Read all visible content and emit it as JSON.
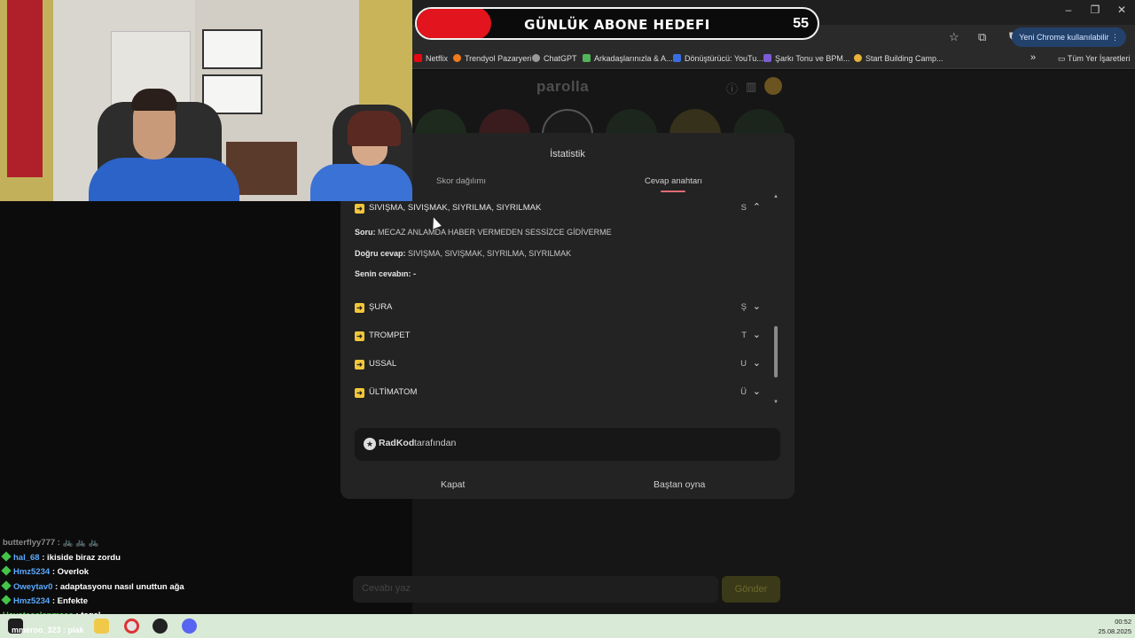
{
  "overlay": {
    "title": "GÜNLÜK ABONE HEDEFI",
    "count": "55"
  },
  "browser": {
    "window_controls": [
      "–",
      "❐",
      "✕"
    ],
    "chrome_pill": "Yeni Chrome kullanılabilir",
    "bookmarks": [
      "Netflix",
      "Trendyol Pazaryeri",
      "ChatGPT",
      "Arkadaşlarınızla & A...",
      "Dönüştürücü: YouTu...",
      "Şarkı Tonu ve BPM...",
      "Start Building Camp..."
    ],
    "bookmarks_more": "»",
    "all_bookmarks": "Tüm Yer İşaretleri"
  },
  "game": {
    "title": "parolla",
    "input_placeholder": "Cevabı yaz",
    "submit_label": "Gönder"
  },
  "modal": {
    "title": "İstatistik",
    "tabs": [
      "Skor dağılımı",
      "Cevap anahtarı"
    ],
    "active_tab": "Cevap anahtarı",
    "expanded": {
      "word": "SIVIŞMA, SIVIŞMAK, SIYRILMA, SIYRILMAK",
      "letter": "S",
      "question_label": "Soru:",
      "question": "MECAZ ANLAMDA HABER VERMEDEN SESSİZCE GİDİVERME",
      "correct_label": "Doğru cevap:",
      "correct": "SIVIŞMA, SIVIŞMAK, SIYRILMA, SIYRILMAK",
      "yours_label": "Senin cevabın:",
      "yours": "-"
    },
    "items": [
      {
        "word": "ŞURA",
        "letter": "Ş"
      },
      {
        "word": "TROMPET",
        "letter": "T"
      },
      {
        "word": "USSAL",
        "letter": "U"
      },
      {
        "word": "ÜLTİMATOM",
        "letter": "Ü"
      }
    ],
    "credit_name": "RadKod",
    "credit_suffix": "tarafından",
    "close_label": "Kapat",
    "restart_label": "Baştan oyna"
  },
  "chat": [
    {
      "user": "butterflyy777",
      "text": "",
      "color": "#8a8a8a"
    },
    {
      "user": "hal_68",
      "text": "ikiside biraz zordu"
    },
    {
      "user": "Hmz5234",
      "text": "Overlok"
    },
    {
      "user": "Oweytav0",
      "text": "adaptasyonu nasıl unuttun ağa"
    },
    {
      "user": "Hmz5234",
      "text": "Enfekte"
    },
    {
      "user": "Hayatacelenmeee",
      "text": "tegel"
    }
  ],
  "taskbar": {
    "overlay_text": "mmeroo_323",
    "overlay_text2": "plak",
    "time": "00:52",
    "date": "25.08.2025"
  },
  "colors": {
    "accent_yellow": "#f2c63a",
    "tab_underline": "#e06c74",
    "overlay_red": "#e2141d"
  }
}
